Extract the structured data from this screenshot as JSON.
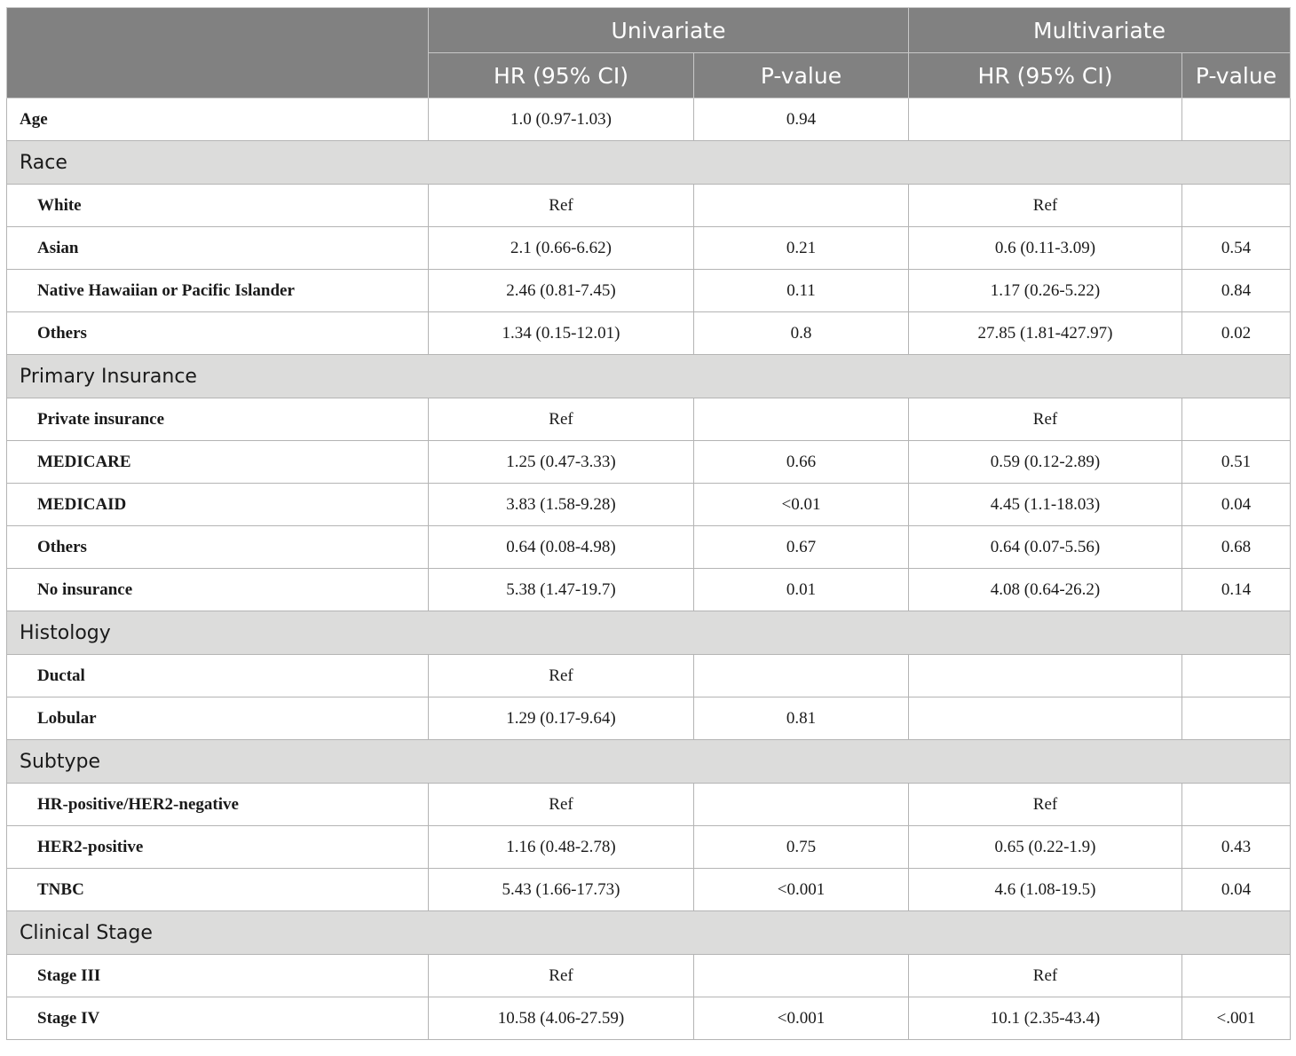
{
  "header": {
    "univariate": "Univariate",
    "multivariate": "Multivariate",
    "hr_ci": "HR (95% CI)",
    "p_value": "P-value"
  },
  "rows": [
    {
      "type": "data",
      "label": "Age",
      "top": true,
      "uni_hr": "1.0 (0.97-1.03)",
      "uni_p": "0.94",
      "multi_hr": "",
      "multi_p": ""
    },
    {
      "type": "section",
      "label": "Race"
    },
    {
      "type": "data",
      "label": "White",
      "uni_hr": "Ref",
      "uni_p": "",
      "multi_hr": "Ref",
      "multi_p": ""
    },
    {
      "type": "data",
      "label": "Asian",
      "uni_hr": "2.1 (0.66-6.62)",
      "uni_p": "0.21",
      "multi_hr": "0.6 (0.11-3.09)",
      "multi_p": "0.54"
    },
    {
      "type": "data",
      "label": "Native Hawaiian or Pacific Islander",
      "uni_hr": "2.46 (0.81-7.45)",
      "uni_p": "0.11",
      "multi_hr": "1.17 (0.26-5.22)",
      "multi_p": "0.84"
    },
    {
      "type": "data",
      "label": "Others",
      "uni_hr": "1.34 (0.15-12.01)",
      "uni_p": "0.8",
      "multi_hr": "27.85 (1.81-427.97)",
      "multi_p": "0.02"
    },
    {
      "type": "section",
      "label": "Primary Insurance"
    },
    {
      "type": "data",
      "label": "Private insurance",
      "uni_hr": "Ref",
      "uni_p": "",
      "multi_hr": "Ref",
      "multi_p": ""
    },
    {
      "type": "data",
      "label": "MEDICARE",
      "uni_hr": "1.25 (0.47-3.33)",
      "uni_p": "0.66",
      "multi_hr": "0.59 (0.12-2.89)",
      "multi_p": "0.51"
    },
    {
      "type": "data",
      "label": "MEDICAID",
      "uni_hr": "3.83 (1.58-9.28)",
      "uni_p": "<0.01",
      "multi_hr": "4.45 (1.1-18.03)",
      "multi_p": "0.04"
    },
    {
      "type": "data",
      "label": "Others",
      "uni_hr": "0.64 (0.08-4.98)",
      "uni_p": "0.67",
      "multi_hr": "0.64 (0.07-5.56)",
      "multi_p": "0.68"
    },
    {
      "type": "data",
      "label": "No insurance",
      "uni_hr": "5.38 (1.47-19.7)",
      "uni_p": "0.01",
      "multi_hr": "4.08 (0.64-26.2)",
      "multi_p": "0.14"
    },
    {
      "type": "section",
      "label": "Histology"
    },
    {
      "type": "data",
      "label": "Ductal",
      "uni_hr": "Ref",
      "uni_p": "",
      "multi_hr": "",
      "multi_p": ""
    },
    {
      "type": "data",
      "label": "Lobular",
      "uni_hr": "1.29 (0.17-9.64)",
      "uni_p": "0.81",
      "multi_hr": "",
      "multi_p": ""
    },
    {
      "type": "section",
      "label": "Subtype"
    },
    {
      "type": "data",
      "label": "HR-positive/HER2-negative",
      "uni_hr": "Ref",
      "uni_p": "",
      "multi_hr": "Ref",
      "multi_p": ""
    },
    {
      "type": "data",
      "label": "HER2-positive",
      "uni_hr": "1.16 (0.48-2.78)",
      "uni_p": "0.75",
      "multi_hr": "0.65 (0.22-1.9)",
      "multi_p": "0.43"
    },
    {
      "type": "data",
      "label": "TNBC",
      "uni_hr": "5.43 (1.66-17.73)",
      "uni_p": "<0.001",
      "multi_hr": "4.6 (1.08-19.5)",
      "multi_p": "0.04"
    },
    {
      "type": "section",
      "label": "Clinical Stage"
    },
    {
      "type": "data",
      "label": "Stage III",
      "uni_hr": "Ref",
      "uni_p": "",
      "multi_hr": "Ref",
      "multi_p": ""
    },
    {
      "type": "data",
      "label": "Stage IV",
      "uni_hr": "10.58 (4.06-27.59)",
      "uni_p": "<0.001",
      "multi_hr": "10.1 (2.35-43.4)",
      "multi_p": "<.001"
    }
  ]
}
